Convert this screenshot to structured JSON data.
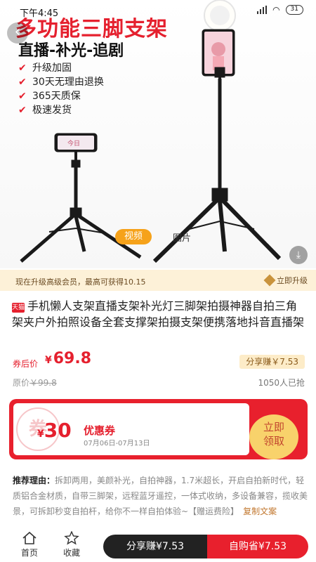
{
  "statusbar": {
    "time": "下午4:45",
    "battery": "31"
  },
  "hero": {
    "title": "多功能三脚支架",
    "subtitle": "直播-补光-追剧",
    "features": [
      "升级加固",
      "30天无理由退换",
      "365天质保",
      "极速发货"
    ],
    "video_badge": "视频",
    "picture_label": "图片",
    "phone_label": "今日",
    "brand_color": "#e5202e"
  },
  "member": {
    "text": "现在升级高级会员，最高可获得10.15",
    "upgrade_label": "立即升级"
  },
  "product": {
    "store_badge": "天猫",
    "title": "手机懒人支架直播支架补光灯三脚架拍摄神器自拍三角架夹户外拍照设备全套支撑架拍摄支架便携落地抖音直播架",
    "coupon_price_label": "券后价",
    "currency": "¥",
    "price": "69.8",
    "share_earn": "分享赚￥7.53",
    "orig_label": "原价",
    "orig_price": "￥99.8",
    "sold": "1050人已抢"
  },
  "coupon": {
    "seal_text": "券",
    "currency": "¥",
    "value": "30",
    "name": "优惠券",
    "dates": "07月06日-07月13日",
    "claim_line1": "立即",
    "claim_line2": "领取"
  },
  "recommend": {
    "lead": "推荐理由：",
    "text": "拆卸两用，美颜补光，自拍神器，1.7米超长，开启自拍新时代，轻质铝合金材质，自带三脚架，远程蓝牙遥控，一体式收纳，多设备兼容，揽收美景，可拆卸秒变自拍杆，给你不一样自拍体验~【赠运费险】",
    "copy_label": "复制文案"
  },
  "bottombar": {
    "home_label": "首页",
    "fav_label": "收藏",
    "share_button": "分享赚¥7.53",
    "buy_button": "自购省¥7.53"
  }
}
